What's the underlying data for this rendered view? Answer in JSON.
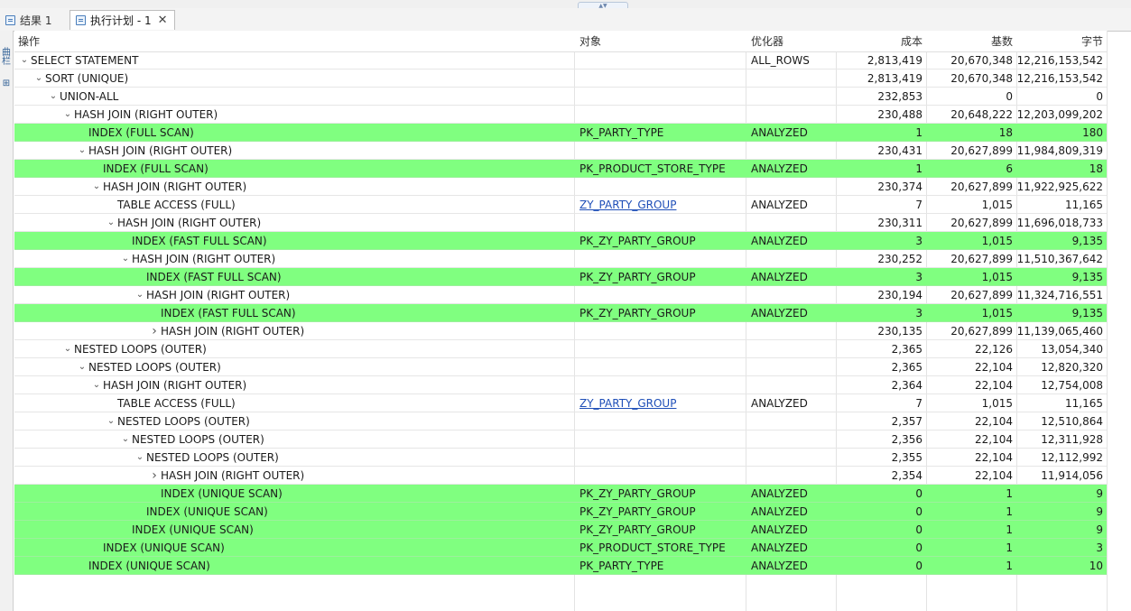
{
  "tabs": {
    "results_label": "结果 1",
    "plan_label": "执行计划 - 1"
  },
  "side_panel": {
    "btn1": "曲 栏",
    "btn2": "⊞"
  },
  "columns": {
    "operation": "操作",
    "object": "对象",
    "optimizer": "优化器",
    "cost": "成本",
    "cardinality": "基数",
    "bytes": "字节"
  },
  "rows": [
    {
      "op": "SELECT STATEMENT",
      "obj": "",
      "opt": "ALL_ROWS",
      "cost": "2,813,419",
      "card": "20,670,348",
      "bytes": "12,216,153,542"
    },
    {
      "op": "SORT (UNIQUE)",
      "obj": "",
      "opt": "",
      "cost": "2,813,419",
      "card": "20,670,348",
      "bytes": "12,216,153,542"
    },
    {
      "op": "UNION-ALL",
      "obj": "",
      "opt": "",
      "cost": "232,853",
      "card": "0",
      "bytes": "0"
    },
    {
      "op": "HASH JOIN (RIGHT OUTER)",
      "obj": "",
      "opt": "",
      "cost": "230,488",
      "card": "20,648,222",
      "bytes": "12,203,099,202"
    },
    {
      "op": "INDEX (FULL SCAN)",
      "obj": "PK_PARTY_TYPE",
      "opt": "ANALYZED",
      "cost": "1",
      "card": "18",
      "bytes": "180"
    },
    {
      "op": "HASH JOIN (RIGHT OUTER)",
      "obj": "",
      "opt": "",
      "cost": "230,431",
      "card": "20,627,899",
      "bytes": "11,984,809,319"
    },
    {
      "op": "INDEX (FULL SCAN)",
      "obj": "PK_PRODUCT_STORE_TYPE",
      "opt": "ANALYZED",
      "cost": "1",
      "card": "6",
      "bytes": "18"
    },
    {
      "op": "HASH JOIN (RIGHT OUTER)",
      "obj": "",
      "opt": "",
      "cost": "230,374",
      "card": "20,627,899",
      "bytes": "11,922,925,622"
    },
    {
      "op": "TABLE ACCESS (FULL)",
      "obj": "ZY_PARTY_GROUP",
      "opt": "ANALYZED",
      "cost": "7",
      "card": "1,015",
      "bytes": "11,165"
    },
    {
      "op": "HASH JOIN (RIGHT OUTER)",
      "obj": "",
      "opt": "",
      "cost": "230,311",
      "card": "20,627,899",
      "bytes": "11,696,018,733"
    },
    {
      "op": "INDEX (FAST FULL SCAN)",
      "obj": "PK_ZY_PARTY_GROUP",
      "opt": "ANALYZED",
      "cost": "3",
      "card": "1,015",
      "bytes": "9,135"
    },
    {
      "op": "HASH JOIN (RIGHT OUTER)",
      "obj": "",
      "opt": "",
      "cost": "230,252",
      "card": "20,627,899",
      "bytes": "11,510,367,642"
    },
    {
      "op": "INDEX (FAST FULL SCAN)",
      "obj": "PK_ZY_PARTY_GROUP",
      "opt": "ANALYZED",
      "cost": "3",
      "card": "1,015",
      "bytes": "9,135"
    },
    {
      "op": "HASH JOIN (RIGHT OUTER)",
      "obj": "",
      "opt": "",
      "cost": "230,194",
      "card": "20,627,899",
      "bytes": "11,324,716,551"
    },
    {
      "op": "INDEX (FAST FULL SCAN)",
      "obj": "PK_ZY_PARTY_GROUP",
      "opt": "ANALYZED",
      "cost": "3",
      "card": "1,015",
      "bytes": "9,135"
    },
    {
      "op": "HASH JOIN (RIGHT OUTER)",
      "obj": "",
      "opt": "",
      "cost": "230,135",
      "card": "20,627,899",
      "bytes": "11,139,065,460"
    },
    {
      "op": "NESTED LOOPS (OUTER)",
      "obj": "",
      "opt": "",
      "cost": "2,365",
      "card": "22,126",
      "bytes": "13,054,340"
    },
    {
      "op": "NESTED LOOPS (OUTER)",
      "obj": "",
      "opt": "",
      "cost": "2,365",
      "card": "22,104",
      "bytes": "12,820,320"
    },
    {
      "op": "HASH JOIN (RIGHT OUTER)",
      "obj": "",
      "opt": "",
      "cost": "2,364",
      "card": "22,104",
      "bytes": "12,754,008"
    },
    {
      "op": "TABLE ACCESS (FULL)",
      "obj": "ZY_PARTY_GROUP",
      "opt": "ANALYZED",
      "cost": "7",
      "card": "1,015",
      "bytes": "11,165"
    },
    {
      "op": "NESTED LOOPS (OUTER)",
      "obj": "",
      "opt": "",
      "cost": "2,357",
      "card": "22,104",
      "bytes": "12,510,864"
    },
    {
      "op": "NESTED LOOPS (OUTER)",
      "obj": "",
      "opt": "",
      "cost": "2,356",
      "card": "22,104",
      "bytes": "12,311,928"
    },
    {
      "op": "NESTED LOOPS (OUTER)",
      "obj": "",
      "opt": "",
      "cost": "2,355",
      "card": "22,104",
      "bytes": "12,112,992"
    },
    {
      "op": "HASH JOIN (RIGHT OUTER)",
      "obj": "",
      "opt": "",
      "cost": "2,354",
      "card": "22,104",
      "bytes": "11,914,056"
    },
    {
      "op": "INDEX (UNIQUE SCAN)",
      "obj": "PK_ZY_PARTY_GROUP",
      "opt": "ANALYZED",
      "cost": "0",
      "card": "1",
      "bytes": "9"
    },
    {
      "op": "INDEX (UNIQUE SCAN)",
      "obj": "PK_ZY_PARTY_GROUP",
      "opt": "ANALYZED",
      "cost": "0",
      "card": "1",
      "bytes": "9"
    },
    {
      "op": "INDEX (UNIQUE SCAN)",
      "obj": "PK_ZY_PARTY_GROUP",
      "opt": "ANALYZED",
      "cost": "0",
      "card": "1",
      "bytes": "9"
    },
    {
      "op": "INDEX (UNIQUE SCAN)",
      "obj": "PK_PRODUCT_STORE_TYPE",
      "opt": "ANALYZED",
      "cost": "0",
      "card": "1",
      "bytes": "3"
    },
    {
      "op": "INDEX (UNIQUE SCAN)",
      "obj": "PK_PARTY_TYPE",
      "opt": "ANALYZED",
      "cost": "0",
      "card": "1",
      "bytes": "10"
    }
  ],
  "highlight_color": "#80ff80",
  "link_color": "#1f4fb8"
}
